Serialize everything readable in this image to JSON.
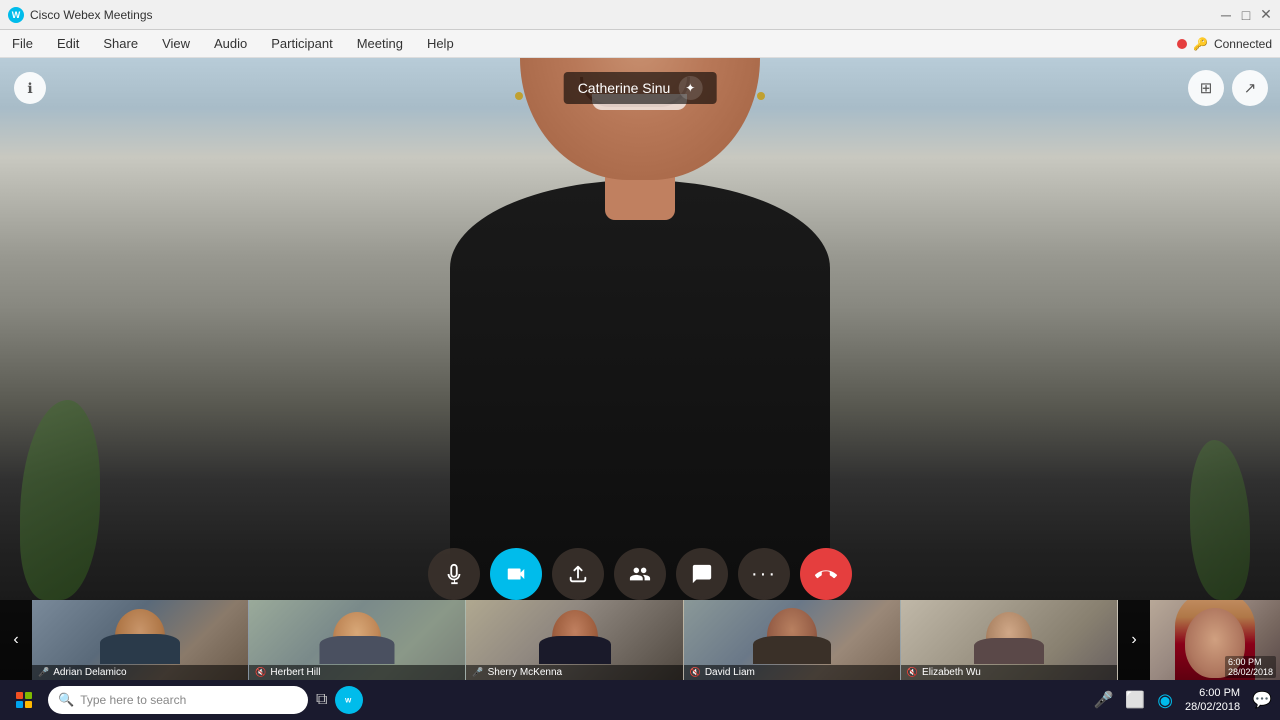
{
  "titlebar": {
    "app_name": "Cisco Webex Meetings",
    "minimize": "─",
    "maximize": "□",
    "close": "✕"
  },
  "menubar": {
    "items": [
      "File",
      "Edit",
      "Share",
      "View",
      "Audio",
      "Participant",
      "Meeting",
      "Help"
    ],
    "connection_status": "Connected"
  },
  "main_video": {
    "speaker_name": "Catherine Sinu"
  },
  "controls": {
    "mute": "🎤",
    "video": "📹",
    "share": "⬆",
    "participants": "👤",
    "chat": "💬",
    "more": "•••",
    "end": "✕"
  },
  "thumbnails": [
    {
      "name": "Adrian Delamico",
      "muted": false
    },
    {
      "name": "Herbert Hill",
      "muted": true
    },
    {
      "name": "Sherry McKenna",
      "muted": false
    },
    {
      "name": "David Liam",
      "muted": true
    },
    {
      "name": "Elizabeth Wu",
      "muted": true
    }
  ],
  "taskbar": {
    "search_placeholder": "Type here to search",
    "time": "6:00 PM",
    "date": "28/02/2018"
  }
}
